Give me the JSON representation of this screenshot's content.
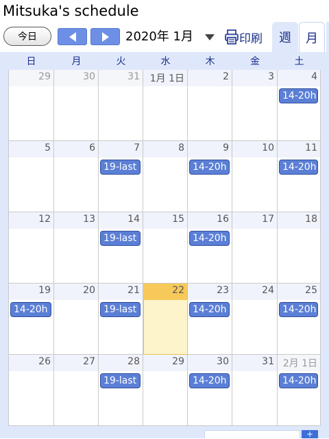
{
  "header": {
    "title": "Mitsuka's schedule",
    "today_label": "今日",
    "prev_icon": "chevron-left-icon",
    "next_icon": "chevron-right-icon",
    "month_label": "2020年 1月",
    "print_label": "印刷",
    "print_icon": "printer-icon"
  },
  "tabs": [
    {
      "label": "週",
      "active": false
    },
    {
      "label": "月",
      "active": true
    }
  ],
  "weekdays": [
    "日",
    "月",
    "火",
    "水",
    "木",
    "金",
    "土"
  ],
  "weeks": [
    [
      {
        "day": "29",
        "other": true
      },
      {
        "day": "30",
        "other": true
      },
      {
        "day": "31",
        "other": true
      },
      {
        "day": "1月 1日"
      },
      {
        "day": "2"
      },
      {
        "day": "3"
      },
      {
        "day": "4",
        "event": "14-20h"
      }
    ],
    [
      {
        "day": "5"
      },
      {
        "day": "6"
      },
      {
        "day": "7",
        "event": "19-last"
      },
      {
        "day": "8"
      },
      {
        "day": "9",
        "event": "14-20h"
      },
      {
        "day": "10"
      },
      {
        "day": "11",
        "event": "14-20h"
      }
    ],
    [
      {
        "day": "12"
      },
      {
        "day": "13"
      },
      {
        "day": "14",
        "event": "19-last"
      },
      {
        "day": "15"
      },
      {
        "day": "16",
        "event": "14-20h"
      },
      {
        "day": "17"
      },
      {
        "day": "18"
      }
    ],
    [
      {
        "day": "19",
        "event": "14-20h"
      },
      {
        "day": "20"
      },
      {
        "day": "21",
        "event": "19-last"
      },
      {
        "day": "22",
        "today": true
      },
      {
        "day": "23",
        "event": "14-20h"
      },
      {
        "day": "24"
      },
      {
        "day": "25",
        "event": "14-20h"
      }
    ],
    [
      {
        "day": "26"
      },
      {
        "day": "27"
      },
      {
        "day": "28",
        "event": "19-last"
      },
      {
        "day": "29"
      },
      {
        "day": "30",
        "event": "14-20h"
      },
      {
        "day": "31"
      },
      {
        "day": "2月 1日",
        "other": true,
        "event": "14-20h"
      }
    ]
  ],
  "colors": {
    "accent": "#6d8fe6",
    "event": "#5b7fd6",
    "today": "#f7c95a",
    "calendar_bg": "#dfe8fb"
  }
}
